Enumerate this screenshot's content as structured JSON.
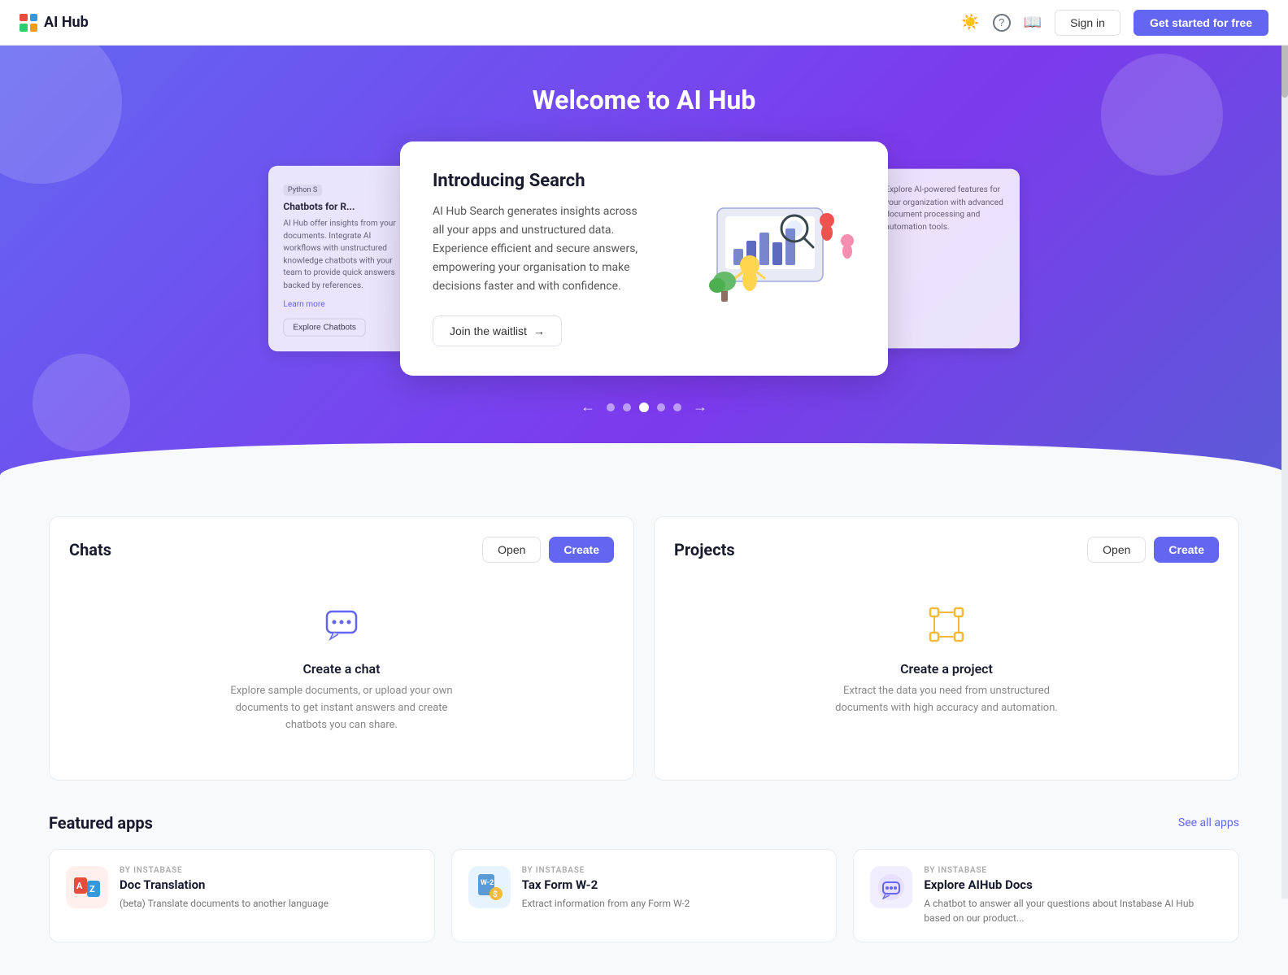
{
  "navbar": {
    "brand": "AI Hub",
    "icons": {
      "sun": "☀",
      "help": "?",
      "book": "📖"
    },
    "signin_label": "Sign in",
    "get_started_label": "Get started for free"
  },
  "hero": {
    "title": "Welcome to AI Hub",
    "carousel": {
      "main_card": {
        "heading": "Introducing Search",
        "body": "AI Hub Search generates insights across all your apps and unstructured data. Experience efficient and secure answers, empowering your organisation to make decisions faster and with confidence.",
        "cta": "Join the waitlist"
      },
      "left_card": {
        "tag": "Python S",
        "heading": "Chatbots for R...",
        "body": "AI Hub offer insights from your ... integrate AI workflows, ... unstructured kno... chatbots with you... to provide quick an... backed by referer...",
        "link": "Learn more",
        "btn": "Explore Chatbots"
      },
      "dots": [
        "dot1",
        "dot2",
        "dot3",
        "dot4",
        "dot5"
      ],
      "active_dot": 2
    }
  },
  "chats_panel": {
    "title": "Chats",
    "open_label": "Open",
    "create_label": "Create",
    "empty": {
      "heading": "Create a chat",
      "body": "Explore sample documents, or upload your own documents to get instant answers and create chatbots you can share."
    }
  },
  "projects_panel": {
    "title": "Projects",
    "open_label": "Open",
    "create_label": "Create",
    "empty": {
      "heading": "Create a project",
      "body": "Extract the data you need from unstructured documents with high accuracy and automation."
    }
  },
  "featured": {
    "section_title": "Featured apps",
    "see_all": "See all apps",
    "apps": [
      {
        "by": "BY INSTABASE",
        "name": "Doc Translation",
        "desc": "(beta) Translate documents to another language",
        "icon_type": "doc"
      },
      {
        "by": "BY INSTABASE",
        "name": "Tax Form W-2",
        "desc": "Extract information from any Form W-2",
        "icon_type": "tax"
      },
      {
        "by": "BY INSTABASE",
        "name": "Explore AIHub Docs",
        "desc": "A chatbot to answer all your questions about Instabase AI Hub based on our product...",
        "icon_type": "explore"
      }
    ]
  }
}
